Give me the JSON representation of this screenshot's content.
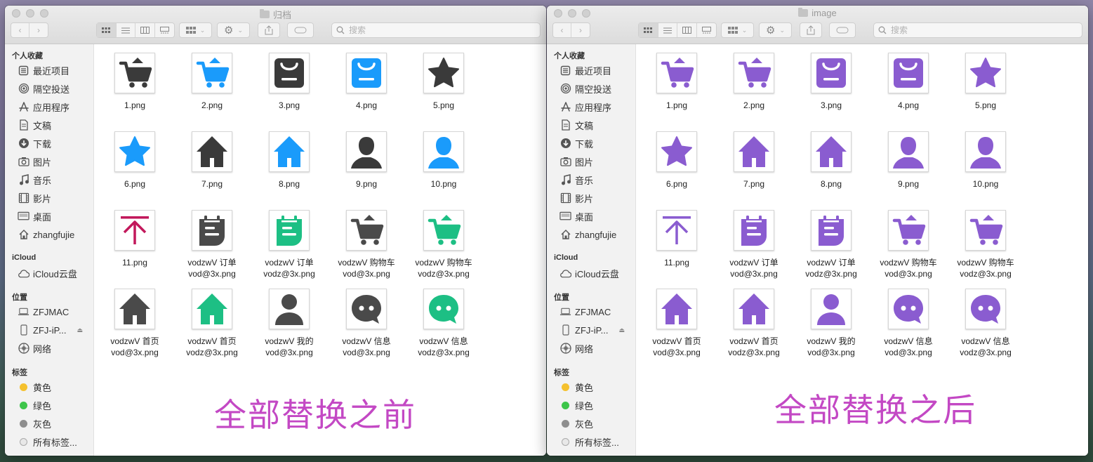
{
  "left_window": {
    "title": "归档",
    "caption": "全部替换之前",
    "files": [
      {
        "name": "1.png",
        "icon": "cart",
        "color": "#3a3a3a"
      },
      {
        "name": "2.png",
        "icon": "cart",
        "color": "#1a9bfb"
      },
      {
        "name": "3.png",
        "icon": "bag",
        "color": "#3a3a3a"
      },
      {
        "name": "4.png",
        "icon": "bag",
        "color": "#1a9bfb"
      },
      {
        "name": "5.png",
        "icon": "star",
        "color": "#3a3a3a"
      },
      {
        "name": "6.png",
        "icon": "star",
        "color": "#1a9bfb"
      },
      {
        "name": "7.png",
        "icon": "house",
        "color": "#3a3a3a"
      },
      {
        "name": "8.png",
        "icon": "house",
        "color": "#1a9bfb"
      },
      {
        "name": "9.png",
        "icon": "person",
        "color": "#3a3a3a"
      },
      {
        "name": "10.png",
        "icon": "person",
        "color": "#1a9bfb"
      },
      {
        "name": "11.png",
        "icon": "upload",
        "color": "#c2185b"
      },
      {
        "name": "vodzwV 订单\nvod@3x.png",
        "icon": "order",
        "color": "#4a4a4a"
      },
      {
        "name": "vodzwV 订单\nvodz@3x.png",
        "icon": "order",
        "color": "#1dbf84"
      },
      {
        "name": "vodzwV 购物车\nvod@3x.png",
        "icon": "cart",
        "color": "#4a4a4a"
      },
      {
        "name": "vodzwV 购物车\nvodz@3x.png",
        "icon": "cart",
        "color": "#1dbf84"
      },
      {
        "name": "vodzwV 首页\nvod@3x.png",
        "icon": "house",
        "color": "#4a4a4a"
      },
      {
        "name": "vodzwV 首页\nvodz@3x.png",
        "icon": "house",
        "color": "#1dbf84"
      },
      {
        "name": "vodzwV 我的\nvod@3x.png",
        "icon": "person-round",
        "color": "#4a4a4a"
      },
      {
        "name": "vodzwV 信息\nvod@3x.png",
        "icon": "chat",
        "color": "#4a4a4a"
      },
      {
        "name": "vodzwV 信息\nvodz@3x.png",
        "icon": "chat",
        "color": "#1dbf84"
      }
    ]
  },
  "right_window": {
    "title": "image",
    "caption": "全部替换之后",
    "files": [
      {
        "name": "1.png",
        "icon": "cart",
        "color": "#8a5cd0"
      },
      {
        "name": "2.png",
        "icon": "cart",
        "color": "#8a5cd0"
      },
      {
        "name": "3.png",
        "icon": "bag",
        "color": "#8a5cd0"
      },
      {
        "name": "4.png",
        "icon": "bag",
        "color": "#8a5cd0"
      },
      {
        "name": "5.png",
        "icon": "star",
        "color": "#8a5cd0"
      },
      {
        "name": "6.png",
        "icon": "star",
        "color": "#8a5cd0"
      },
      {
        "name": "7.png",
        "icon": "house",
        "color": "#8a5cd0"
      },
      {
        "name": "8.png",
        "icon": "house",
        "color": "#8a5cd0"
      },
      {
        "name": "9.png",
        "icon": "person",
        "color": "#8a5cd0"
      },
      {
        "name": "10.png",
        "icon": "person",
        "color": "#8a5cd0"
      },
      {
        "name": "11.png",
        "icon": "upload",
        "color": "#8a5cd0"
      },
      {
        "name": "vodzwV 订单\nvod@3x.png",
        "icon": "order",
        "color": "#8a5cd0"
      },
      {
        "name": "vodzwV 订单\nvodz@3x.png",
        "icon": "order",
        "color": "#8a5cd0"
      },
      {
        "name": "vodzwV 购物车\nvod@3x.png",
        "icon": "cart",
        "color": "#8a5cd0"
      },
      {
        "name": "vodzwV 购物车\nvodz@3x.png",
        "icon": "cart",
        "color": "#8a5cd0"
      },
      {
        "name": "vodzwV 首页\nvod@3x.png",
        "icon": "house",
        "color": "#8a5cd0"
      },
      {
        "name": "vodzwV 首页\nvodz@3x.png",
        "icon": "house",
        "color": "#8a5cd0"
      },
      {
        "name": "vodzwV 我的\nvod@3x.png",
        "icon": "person-round",
        "color": "#8a5cd0"
      },
      {
        "name": "vodzwV 信息\nvod@3x.png",
        "icon": "chat",
        "color": "#8a5cd0"
      },
      {
        "name": "vodzwV 信息\nvodz@3x.png",
        "icon": "chat",
        "color": "#8a5cd0"
      }
    ]
  },
  "search": {
    "placeholder": "搜索"
  },
  "sidebar": {
    "favorites_header": "个人收藏",
    "favorites": [
      {
        "label": "最近项目",
        "icon": "recents-icon"
      },
      {
        "label": "隔空投送",
        "icon": "airdrop-icon"
      },
      {
        "label": "应用程序",
        "icon": "applications-icon"
      },
      {
        "label": "文稿",
        "icon": "documents-icon"
      },
      {
        "label": "下载",
        "icon": "downloads-icon"
      },
      {
        "label": "图片",
        "icon": "camera-icon"
      },
      {
        "label": "音乐",
        "icon": "music-icon"
      },
      {
        "label": "影片",
        "icon": "film-icon"
      },
      {
        "label": "桌面",
        "icon": "desktop-icon"
      },
      {
        "label": "zhangfujie",
        "icon": "home-icon"
      }
    ],
    "icloud_header": "iCloud",
    "icloud": [
      {
        "label": "iCloud云盘",
        "icon": "cloud-icon"
      }
    ],
    "locations_header": "位置",
    "locations": [
      {
        "label": "ZFJMAC",
        "icon": "computer-icon"
      },
      {
        "label": "ZFJ-iP...",
        "icon": "phone-icon"
      },
      {
        "label": "网络",
        "icon": "network-icon"
      }
    ],
    "tags_header": "标签",
    "tags": [
      {
        "label": "黄色",
        "color": "#f5c12e"
      },
      {
        "label": "绿色",
        "color": "#3dc54a"
      },
      {
        "label": "灰色",
        "color": "#8e8e8e"
      },
      {
        "label": "所有标签...",
        "color": ""
      }
    ]
  }
}
